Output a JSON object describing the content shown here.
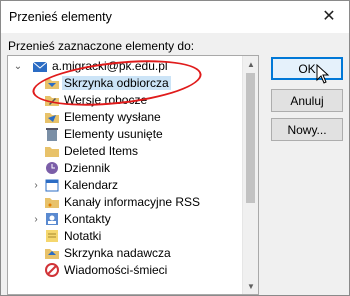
{
  "window": {
    "title": "Przenieś elementy",
    "close_glyph": "✕"
  },
  "prompt": "Przenieś zaznaczone elementy do:",
  "tree": {
    "items": [
      {
        "label": "a.migracki@pk.edu.pl",
        "icon": "mailbox-icon",
        "expander": "collapse",
        "level": 0,
        "selected": false
      },
      {
        "label": "Skrzynka odbiorcza",
        "icon": "inbox-folder-icon",
        "expander": "",
        "level": 1,
        "selected": true
      },
      {
        "label": "Wersje robocze",
        "icon": "drafts-folder-icon",
        "expander": "",
        "level": 1,
        "selected": false
      },
      {
        "label": "Elementy wysłane",
        "icon": "sent-folder-icon",
        "expander": "",
        "level": 1,
        "selected": false
      },
      {
        "label": "Elementy usunięte",
        "icon": "trash-folder-icon",
        "expander": "",
        "level": 1,
        "selected": false
      },
      {
        "label": "Deleted Items",
        "icon": "folder-icon",
        "expander": "",
        "level": 1,
        "selected": false
      },
      {
        "label": "Dziennik",
        "icon": "journal-folder-icon",
        "expander": "",
        "level": 1,
        "selected": false
      },
      {
        "label": "Kalendarz",
        "icon": "calendar-folder-icon",
        "expander": "expand",
        "level": 1,
        "selected": false
      },
      {
        "label": "Kanały informacyjne RSS",
        "icon": "rss-folder-icon",
        "expander": "",
        "level": 1,
        "selected": false
      },
      {
        "label": "Kontakty",
        "icon": "contacts-folder-icon",
        "expander": "expand",
        "level": 1,
        "selected": false
      },
      {
        "label": "Notatki",
        "icon": "notes-folder-icon",
        "expander": "",
        "level": 1,
        "selected": false
      },
      {
        "label": "Skrzynka nadawcza",
        "icon": "outbox-folder-icon",
        "expander": "",
        "level": 1,
        "selected": false
      },
      {
        "label": "Wiadomości-śmieci",
        "icon": "junk-folder-icon",
        "expander": "",
        "level": 1,
        "selected": false
      }
    ]
  },
  "buttons": {
    "ok": "OK",
    "cancel": "Anuluj",
    "new": "Nowy..."
  },
  "colors": {
    "annotation": "#e01b1b",
    "selection": "#cce4f7",
    "default_button_border": "#0078d7"
  }
}
